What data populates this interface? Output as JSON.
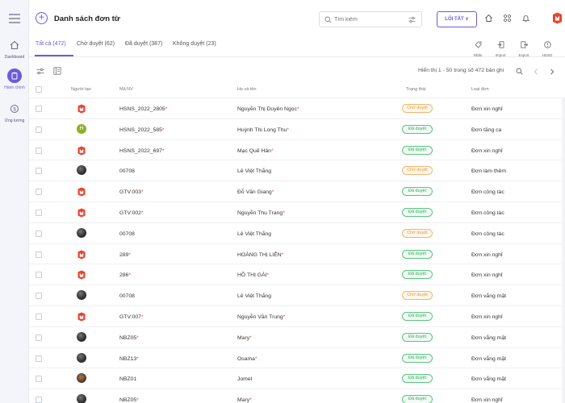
{
  "sidebar": {
    "items": [
      {
        "label": "Dashboard",
        "icon": "home-icon"
      },
      {
        "label": "Hành chính",
        "icon": "clipboard-icon",
        "active": true
      },
      {
        "label": "Ứng lương",
        "icon": "dollar-icon"
      }
    ]
  },
  "header": {
    "title": "Danh sách đơn từ",
    "search_placeholder": "Tìm kiếm",
    "shortcut_label": "LỐI TẮT ∨"
  },
  "tabs": [
    {
      "label": "Tất cả (472)",
      "active": true
    },
    {
      "label": "Chờ duyệt (62)"
    },
    {
      "label": "Đã duyệt (387)"
    },
    {
      "label": "Không duyệt (23)"
    }
  ],
  "tools": [
    {
      "label": "Nhãn",
      "icon": "tag-icon"
    },
    {
      "label": "Import",
      "icon": "import-icon"
    },
    {
      "label": "Export",
      "icon": "export-icon"
    },
    {
      "label": "HDSD",
      "icon": "help-icon"
    }
  ],
  "paging": {
    "text": "Hiển thị 1 - 50 trong số 472 bản ghi"
  },
  "table": {
    "headers": [
      "Người tạo",
      "Mã NV",
      "Họ và tên",
      "Trạng thái",
      "Loại đơn"
    ],
    "rows": [
      {
        "avatar": "logo",
        "code": "HSNS_2022_2805",
        "code_req": true,
        "name": "Nguyễn Thị Duyên Ngọc",
        "name_req": true,
        "status": "Chờ duyệt",
        "status_type": "wait",
        "type": "Đơn xin nghỉ"
      },
      {
        "avatar": "letter",
        "letter": "H",
        "code": "HSNS_2022_585",
        "code_req": true,
        "name": "Huỳnh Thị Long Thu",
        "name_req": true,
        "status": "Đã duyệt",
        "status_type": "ok",
        "type": "Đơn tăng ca"
      },
      {
        "avatar": "logo",
        "code": "HSNS_2022_697",
        "code_req": true,
        "name": "Mạc Quế Hân",
        "name_req": true,
        "status": "Đã duyệt",
        "status_type": "ok",
        "type": "Đơn xin nghỉ"
      },
      {
        "avatar": "photo",
        "code": "00708",
        "code_req": false,
        "name": "Lê Việt Thắng",
        "name_req": false,
        "status": "Chờ duyệt",
        "status_type": "wait",
        "type": "Đơn làm thêm"
      },
      {
        "avatar": "logo",
        "code": "GTV:003",
        "code_req": true,
        "name": "Đỗ Văn Giang",
        "name_req": true,
        "status": "Đã duyệt",
        "status_type": "ok",
        "type": "Đơn công tác"
      },
      {
        "avatar": "logo",
        "code": "GTV:002",
        "code_req": true,
        "name": "Nguyễn Thu Trang",
        "name_req": true,
        "status": "Đã duyệt",
        "status_type": "ok",
        "type": "Đơn công tác"
      },
      {
        "avatar": "photo",
        "code": "00708",
        "code_req": false,
        "name": "Lê Việt Thắng",
        "name_req": false,
        "status": "Chờ duyệt",
        "status_type": "wait",
        "type": "Đơn công tác"
      },
      {
        "avatar": "logo",
        "code": "289",
        "code_req": true,
        "name": "HOÀNG THỊ LIÊN",
        "name_req": true,
        "status": "Đã duyệt",
        "status_type": "ok",
        "type": "Đơn xin nghỉ"
      },
      {
        "avatar": "logo",
        "code": "286",
        "code_req": true,
        "name": "HỒ THỊ GÁI",
        "name_req": true,
        "status": "Đã duyệt",
        "status_type": "ok",
        "type": "Đơn xin nghỉ"
      },
      {
        "avatar": "photo",
        "code": "00708",
        "code_req": false,
        "name": "Lê Việt Thắng",
        "name_req": false,
        "status": "Chờ duyệt",
        "status_type": "wait",
        "type": "Đơn vắng mặt"
      },
      {
        "avatar": "logo",
        "code": "GTV:007",
        "code_req": true,
        "name": "Nguyễn Văn Trung",
        "name_req": true,
        "status": "Đã duyệt",
        "status_type": "ok",
        "type": "Đơn xin nghỉ"
      },
      {
        "avatar": "photo",
        "code": "NBZ05",
        "code_req": true,
        "name": "Mary",
        "name_req": true,
        "status": "Đã duyệt",
        "status_type": "ok",
        "type": "Đơn vắng mặt"
      },
      {
        "avatar": "photo",
        "code": "NBZ13",
        "code_req": true,
        "name": "Osama",
        "name_req": true,
        "status": "Đã duyệt",
        "status_type": "ok",
        "type": "Đơn vắng mặt"
      },
      {
        "avatar": "photo2",
        "code": "NBZ01",
        "code_req": false,
        "name": "Jomel",
        "name_req": false,
        "status": "Đã duyệt",
        "status_type": "ok",
        "type": "Đơn vắng mặt"
      },
      {
        "avatar": "photo",
        "code": "NBZ05",
        "code_req": true,
        "name": "Mary",
        "name_req": true,
        "status": "Đã duyệt",
        "status_type": "ok",
        "type": "Đơn xin nghỉ"
      }
    ]
  },
  "colors": {
    "accent": "#6b5bdc",
    "approved": "#2eab59",
    "pending": "#e6932a",
    "required": "#e04848",
    "brand": "#e8452c"
  }
}
